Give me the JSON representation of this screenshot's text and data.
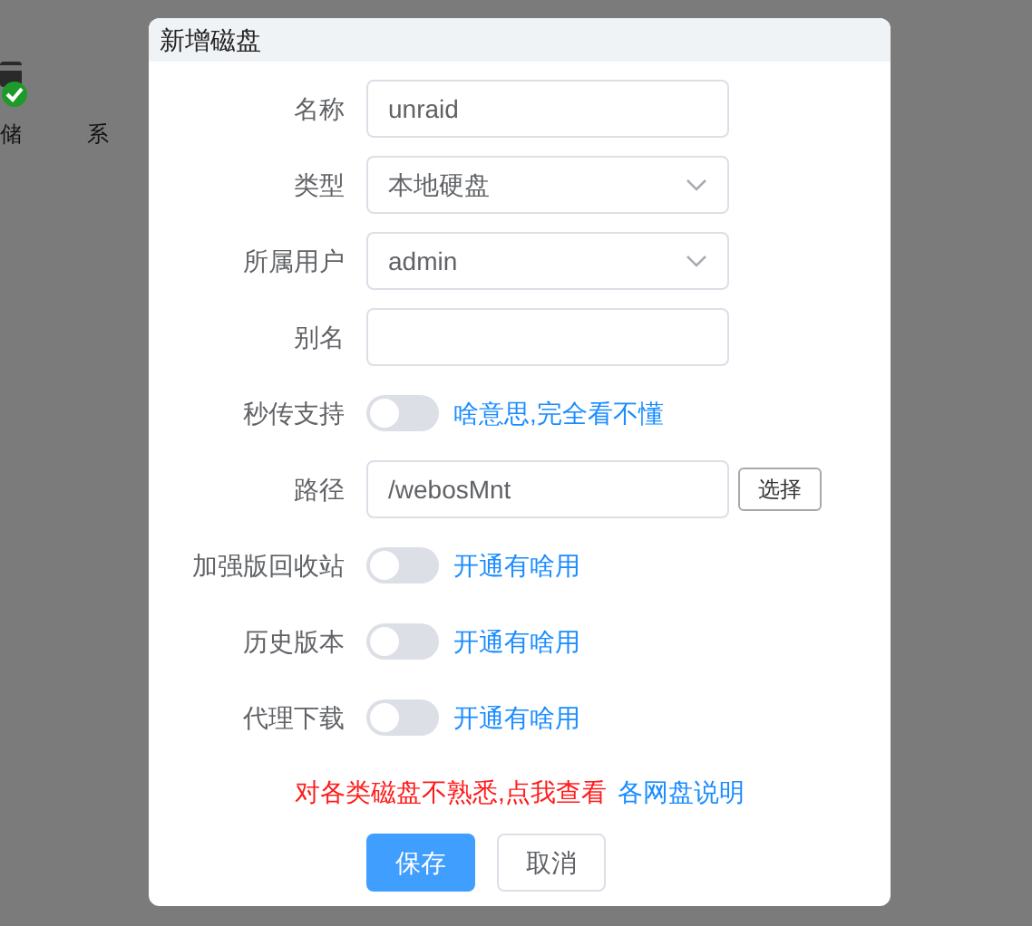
{
  "desktop_icons": [
    {
      "kind": "drive",
      "label": "储"
    },
    {
      "kind": "text",
      "label": "系"
    }
  ],
  "dialog": {
    "title": "新增磁盘",
    "fields": [
      {
        "kind": "input",
        "label": "名称",
        "value": "unraid"
      },
      {
        "kind": "select",
        "label": "类型",
        "value": "本地硬盘"
      },
      {
        "kind": "select",
        "label": "所属用户",
        "value": "admin"
      },
      {
        "kind": "input",
        "label": "别名"
      },
      {
        "kind": "toggle",
        "label": "秒传支持",
        "on": false,
        "link": "啥意思,完全看不懂"
      },
      {
        "kind": "path",
        "label": "路径",
        "value": "/webosMnt",
        "button": "选择"
      },
      {
        "kind": "toggle",
        "label": "加强版回收站",
        "on": false,
        "link": "开通有啥用"
      },
      {
        "kind": "toggle",
        "label": "历史版本",
        "on": false,
        "link": "开通有啥用"
      },
      {
        "kind": "toggle",
        "label": "代理下载",
        "on": false,
        "link": "开通有啥用"
      }
    ],
    "notice": "对各类磁盘不熟悉,点我查看",
    "notice_link": "各网盘说明",
    "buttons": [
      {
        "kind": "primary",
        "label": "保存"
      },
      {
        "kind": "default",
        "label": "取消"
      }
    ]
  }
}
